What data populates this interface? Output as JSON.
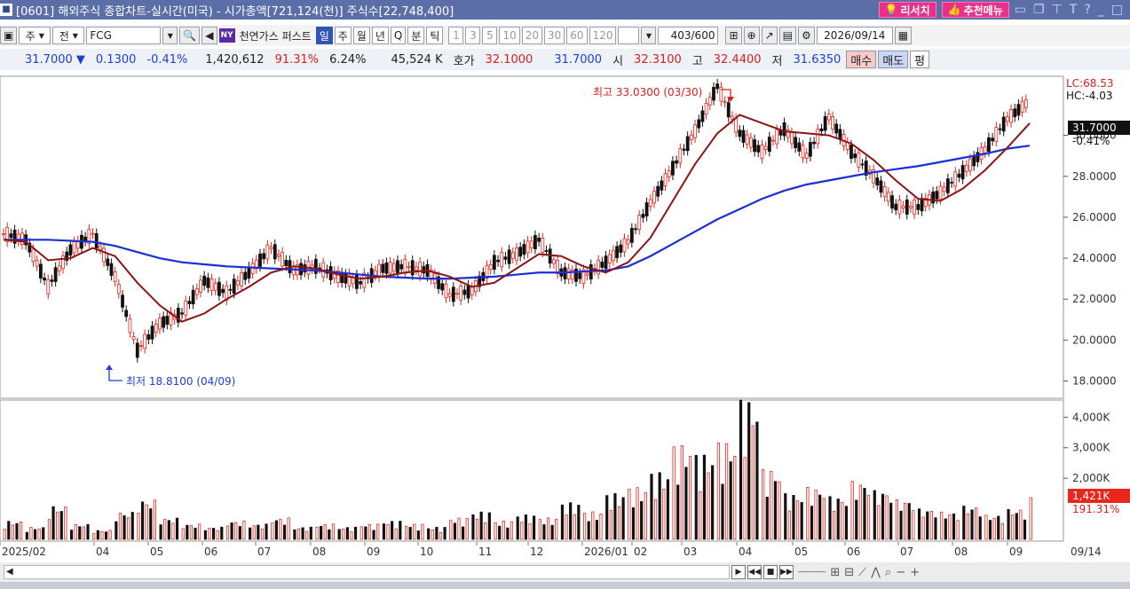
{
  "window": {
    "title": "[0601] 해외주식 종합차트-실시간(미국) - 시가총액[721,124(천)] 주식수[22,748,400]",
    "research_label": "리서치",
    "recommend_label": "추천메뉴"
  },
  "toolbar": {
    "type_label": "주",
    "prev_label": "전",
    "symbol": "FCG",
    "exchange_badge": "NY",
    "name": "천연가스 퍼스트",
    "periods": [
      "일",
      "주",
      "월",
      "년",
      "Q",
      "분",
      "틱"
    ],
    "minute_options": [
      "1",
      "3",
      "5",
      "10",
      "20",
      "30",
      "60",
      "120"
    ],
    "count_value": "403",
    "count_total": "/600",
    "date_value": "2026/09/14"
  },
  "quote": {
    "price": "31.7000",
    "change": "0.1300",
    "change_pct": "-0.41%",
    "volume": "1,420,612",
    "vol_ratio": "91.31%",
    "turnover": "6.24%",
    "trade_amount": "45,524 K",
    "hoga_label": "호가",
    "ask": "32.1000",
    "bid": "31.7000",
    "open_label": "시",
    "open": "32.3100",
    "high_label": "고",
    "high": "32.4400",
    "low_label": "저",
    "low": "31.6350",
    "buy_label": "매수",
    "sell_label": "매도",
    "eval_label": "평"
  },
  "chart_data": {
    "type": "line",
    "symbol": "FCG",
    "price_axis": {
      "ticks": [
        "30.0000",
        "28.0000",
        "26.0000",
        "24.0000",
        "22.0000",
        "20.0000",
        "18.0000"
      ],
      "ylim": [
        17.2,
        32.8
      ],
      "lc_label": "LC:68.53",
      "hc_label": "HC:-4.03",
      "current_tag": "31.7000",
      "current_pct_tag": "-0.41%"
    },
    "volume_axis": {
      "ticks": [
        "4,000K",
        "3,000K",
        "2,000K"
      ],
      "current_tag": "1,421K",
      "ratio_tag": "191.31%"
    },
    "x_labels": [
      "2025/02",
      "04",
      "05",
      "06",
      "07",
      "08",
      "09",
      "10",
      "11",
      "12",
      "2026/01",
      "02",
      "03",
      "04",
      "05",
      "06",
      "07",
      "08",
      "09"
    ],
    "last_date_label": "09/14",
    "annotations": {
      "high": "최고 33.0300 (03/30)",
      "low": "최저 18.8100 (04/09)"
    },
    "price_series": [
      [
        "2025-01",
        25.2
      ],
      [
        "2025-02",
        24.9
      ],
      [
        "2025-02m",
        22.6
      ],
      [
        "2025-03",
        24.4
      ],
      [
        "2025-03m",
        25.2
      ],
      [
        "2025-04",
        23.1
      ],
      [
        "2025-04a",
        19.5
      ],
      [
        "2025-04b",
        20.8
      ],
      [
        "2025-05",
        21.3
      ],
      [
        "2025-05m",
        22.9
      ],
      [
        "2025-06",
        22.3
      ],
      [
        "2025-06m",
        23.3
      ],
      [
        "2025-06b",
        24.5
      ],
      [
        "2025-07",
        23.4
      ],
      [
        "2025-07m",
        23.6
      ],
      [
        "2025-08",
        23.1
      ],
      [
        "2025-08m",
        22.8
      ],
      [
        "2025-09",
        23.5
      ],
      [
        "2025-09m",
        23.6
      ],
      [
        "2025-10",
        23.4
      ],
      [
        "2025-10m",
        22.2
      ],
      [
        "2025-11",
        22.4
      ],
      [
        "2025-11m",
        23.8
      ],
      [
        "2025-12",
        24.2
      ],
      [
        "2025-12m",
        24.9
      ],
      [
        "2026-01",
        23.3
      ],
      [
        "2026-01m",
        23.1
      ],
      [
        "2026-02",
        23.8
      ],
      [
        "2026-02m",
        24.8
      ],
      [
        "2026-03",
        26.7
      ],
      [
        "2026-03m",
        28.4
      ],
      [
        "2026-03e",
        30.2
      ],
      [
        "2026-03z",
        32.4
      ],
      [
        "2026-04",
        30.1
      ],
      [
        "2026-04m",
        29.2
      ],
      [
        "2026-05",
        30.3
      ],
      [
        "2026-05m",
        29.0
      ],
      [
        "2026-05e",
        30.9
      ],
      [
        "2026-06",
        29.2
      ],
      [
        "2026-06m",
        28.0
      ],
      [
        "2026-07",
        26.5
      ],
      [
        "2026-07m",
        26.5
      ],
      [
        "2026-08",
        27.2
      ],
      [
        "2026-08m",
        28.2
      ],
      [
        "2026-08e",
        29.3
      ],
      [
        "2026-09",
        30.8
      ],
      [
        "2026-09m",
        31.7
      ]
    ],
    "ma_short": [
      24.9,
      24.8,
      23.9,
      24.0,
      24.5,
      24.1,
      22.8,
      21.7,
      20.9,
      21.3,
      22.0,
      22.6,
      23.3,
      23.6,
      23.5,
      23.2,
      23.0,
      23.1,
      23.3,
      23.4,
      23.1,
      22.6,
      22.8,
      23.5,
      24.2,
      24.1,
      23.6,
      23.3,
      23.8,
      25.0,
      26.8,
      28.6,
      30.1,
      31.0,
      30.6,
      30.2,
      30.1,
      30.0,
      29.6,
      28.8,
      27.8,
      26.9,
      26.8,
      27.4,
      28.3,
      29.4,
      30.6
    ],
    "ma_long": [
      24.9,
      24.9,
      24.9,
      24.85,
      24.8,
      24.6,
      24.3,
      24.0,
      23.8,
      23.7,
      23.6,
      23.55,
      23.5,
      23.45,
      23.4,
      23.3,
      23.2,
      23.1,
      23.05,
      23.0,
      23.0,
      23.05,
      23.1,
      23.2,
      23.3,
      23.3,
      23.35,
      23.4,
      23.6,
      24.1,
      24.7,
      25.3,
      25.9,
      26.4,
      26.9,
      27.3,
      27.6,
      27.8,
      28.0,
      28.2,
      28.35,
      28.5,
      28.7,
      28.9,
      29.1,
      29.35,
      29.5
    ],
    "volume_series": [
      0.6,
      0.4,
      1.1,
      0.5,
      0.3,
      0.9,
      1.3,
      0.7,
      0.5,
      0.4,
      0.6,
      0.5,
      0.7,
      0.4,
      0.5,
      0.4,
      0.5,
      0.6,
      0.5,
      0.4,
      0.7,
      0.9,
      0.6,
      0.8,
      0.7,
      1.2,
      0.9,
      1.5,
      1.7,
      2.2,
      3.1,
      2.8,
      3.2,
      4.6,
      2.3,
      1.5,
      1.7,
      1.4,
      1.9,
      1.6,
      1.3,
      1.0,
      0.9,
      1.1,
      0.8,
      1.0,
      1.4
    ]
  }
}
